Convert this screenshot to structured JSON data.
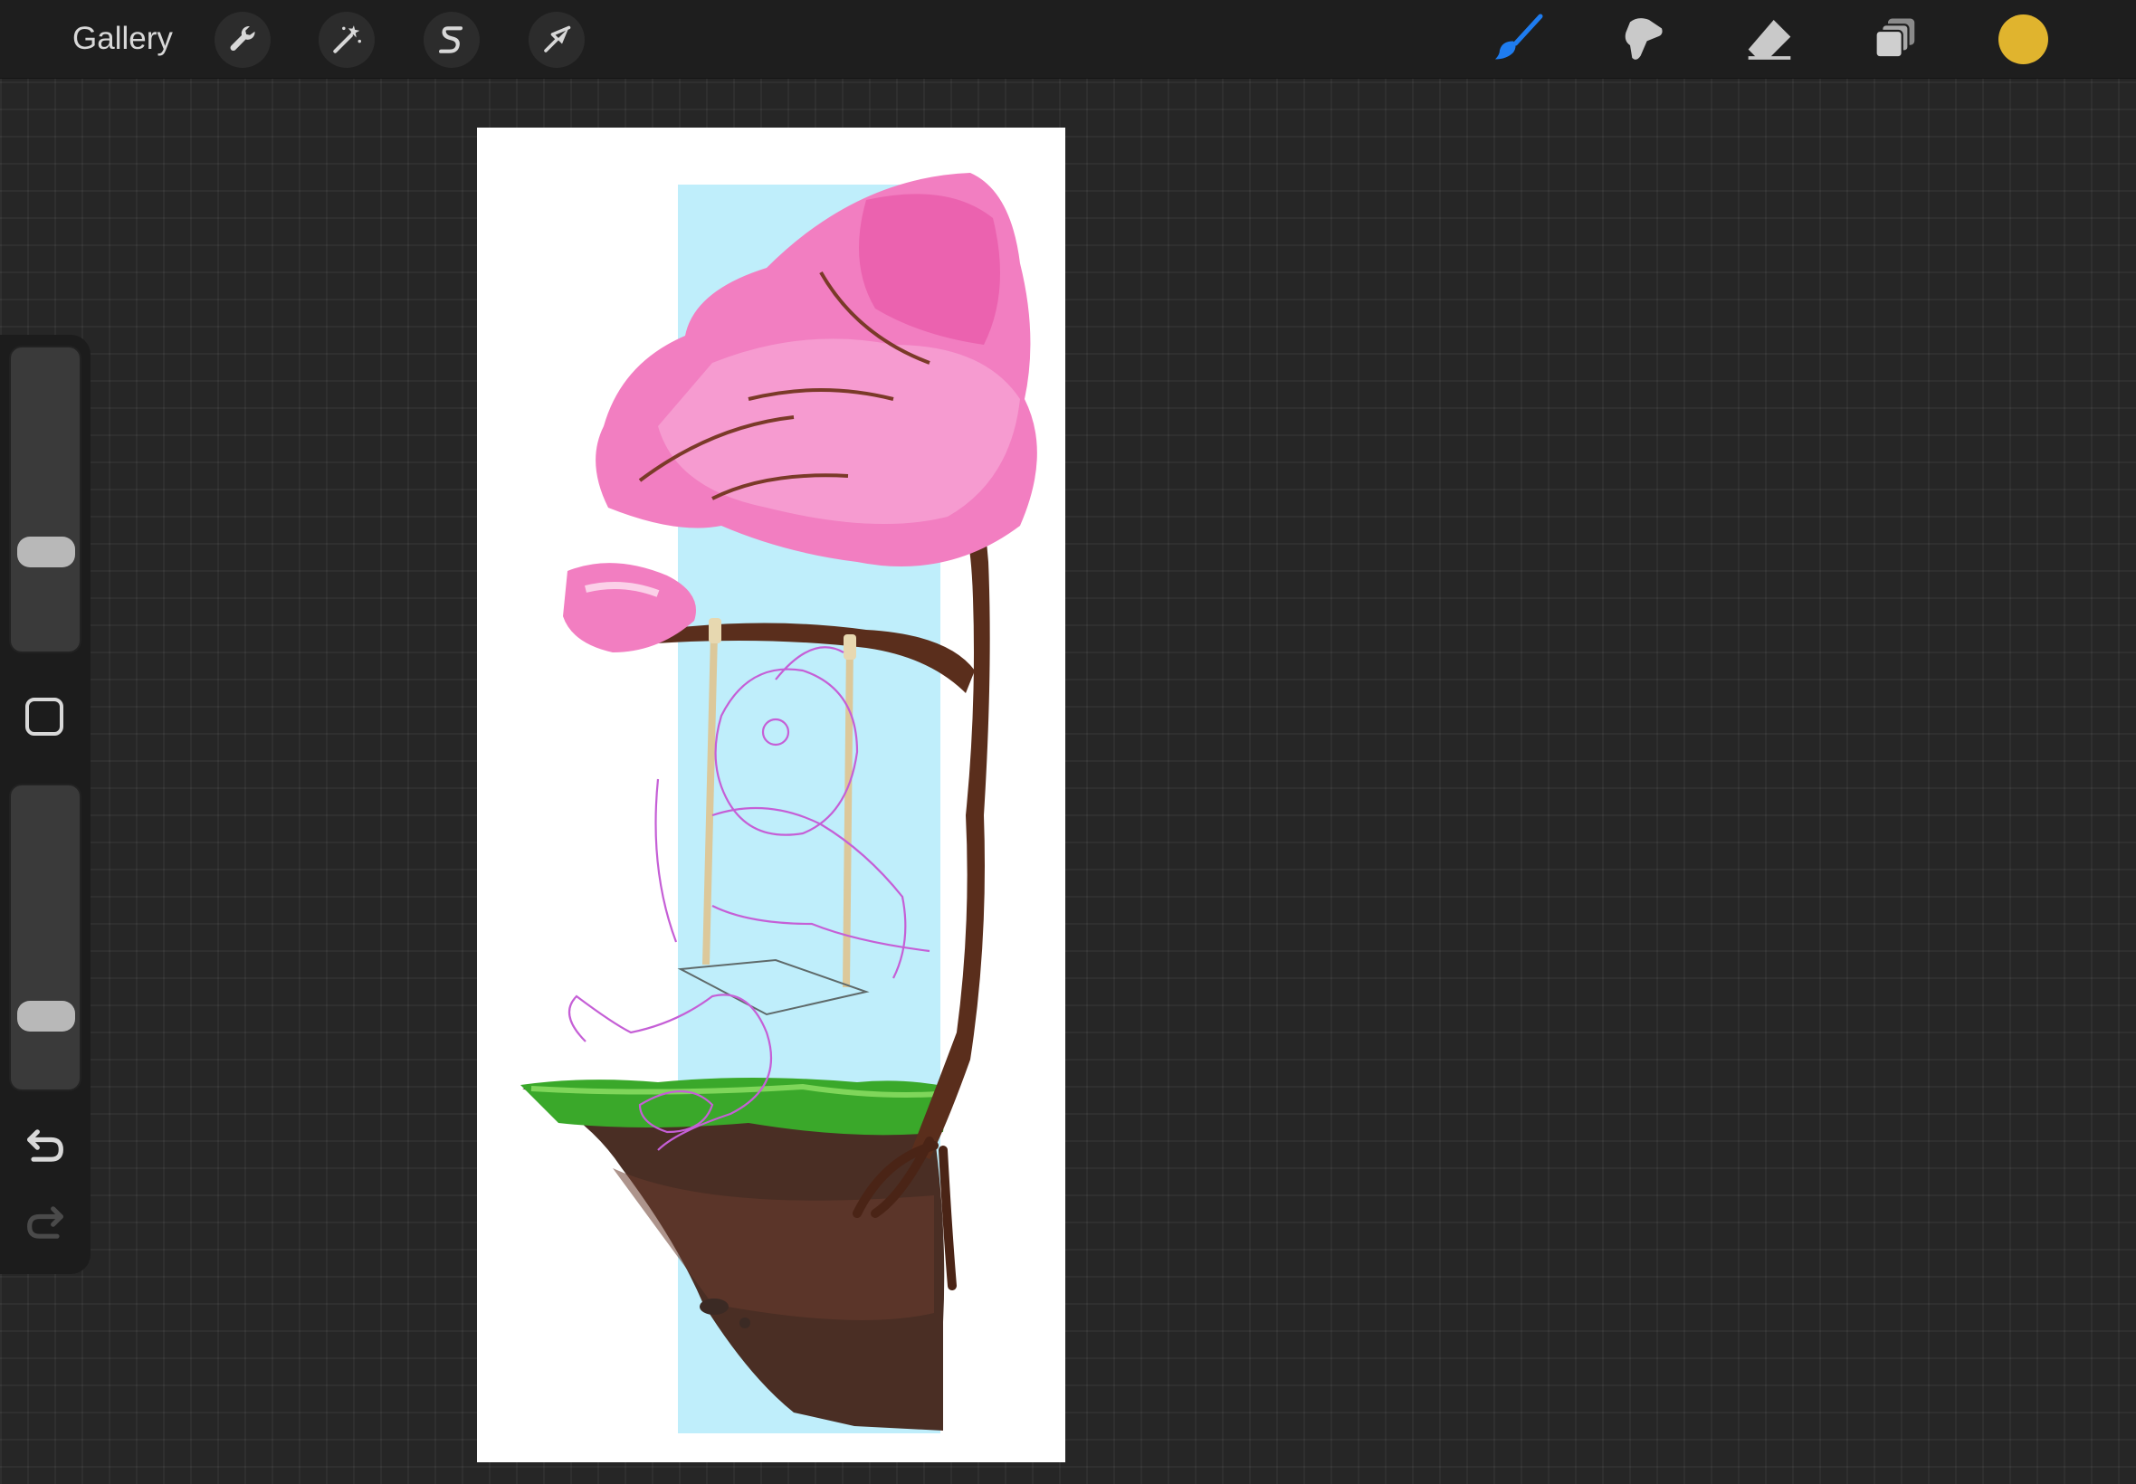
{
  "topbar": {
    "gallery_label": "Gallery",
    "actions_icon": "wrench-icon",
    "adjustments_icon": "magic-wand-icon",
    "selection_icon": "selection-s-icon",
    "transform_icon": "arrow-cursor-icon"
  },
  "right_tools": {
    "brush_icon": "brush-icon",
    "smudge_icon": "smudge-icon",
    "eraser_icon": "eraser-icon",
    "layers_icon": "layers-icon",
    "active_tool": "brush",
    "active_color": "#e0b42e",
    "accent": "#1e7cf0"
  },
  "sidebar": {
    "brush_size_level": 0.3,
    "opacity_level": 0.2,
    "undo_icon": "undo-icon",
    "redo_icon": "redo-icon"
  },
  "canvas": {
    "artwork": "cherry-blossom-tree-floating-island-swing",
    "sky_color": "#bfeefb",
    "blossom_color": "#f27ec1",
    "trunk_color": "#5a2e1c",
    "grass_color": "#3aa82a",
    "sketch_color": "#c55fd6"
  }
}
